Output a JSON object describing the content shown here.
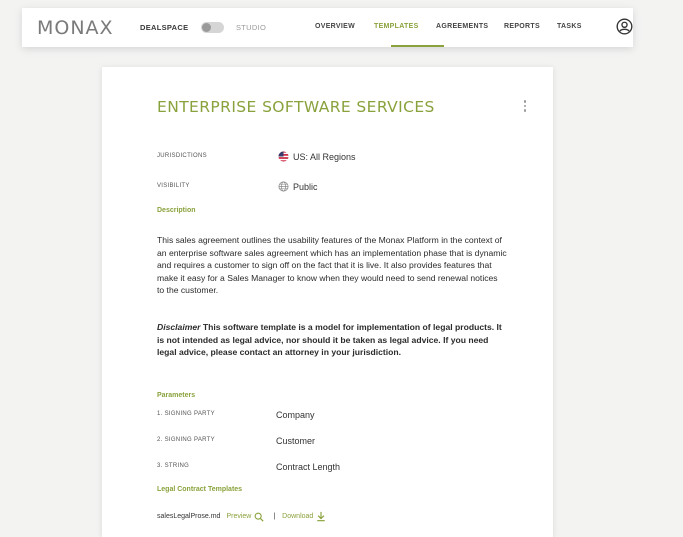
{
  "app": {
    "logo": "MONAX",
    "mode_left": "DEALSPACE",
    "mode_right": "STUDIO"
  },
  "nav": {
    "items": [
      {
        "label": "OVERVIEW",
        "active": false
      },
      {
        "label": "TEMPLATES",
        "active": true
      },
      {
        "label": "AGREEMENTS",
        "active": false
      },
      {
        "label": "REPORTS",
        "active": false
      },
      {
        "label": "TASKS",
        "active": false
      }
    ]
  },
  "template": {
    "title": "ENTERPRISE SOFTWARE SERVICES",
    "jurisdictions_label": "JURISDICTIONS",
    "jurisdictions_value": "US: All Regions",
    "visibility_label": "VISIBILITY",
    "visibility_value": "Public",
    "description_heading": "Description",
    "description": "This sales agreement outlines the usability features of the Monax Platform in the context of an enterprise software sales agreement which has an implementation phase that is dynamic and requires a customer to sign off on the fact that it is live. It also provides features that make it easy for a Sales Manager to know when they would need to send renewal notices to the customer.",
    "disclaimer_label": "Disclaimer",
    "disclaimer_text": " This software template is a model for implementation of legal products. It is not intended as legal advice, nor should it be taken as legal advice. If you need legal advice, please contact an attorney in your jurisdiction.",
    "parameters_heading": "Parameters",
    "parameters": [
      {
        "label": "1. SIGNING PARTY",
        "value": "Company"
      },
      {
        "label": "2. SIGNING PARTY",
        "value": "Customer"
      },
      {
        "label": "3. STRING",
        "value": "Contract Length"
      }
    ],
    "legal_heading": "Legal Contract Templates",
    "file_name": "salesLegalProse.md",
    "preview_label": "Preview",
    "download_label": "Download"
  },
  "colors": {
    "accent": "#8aa23c"
  }
}
